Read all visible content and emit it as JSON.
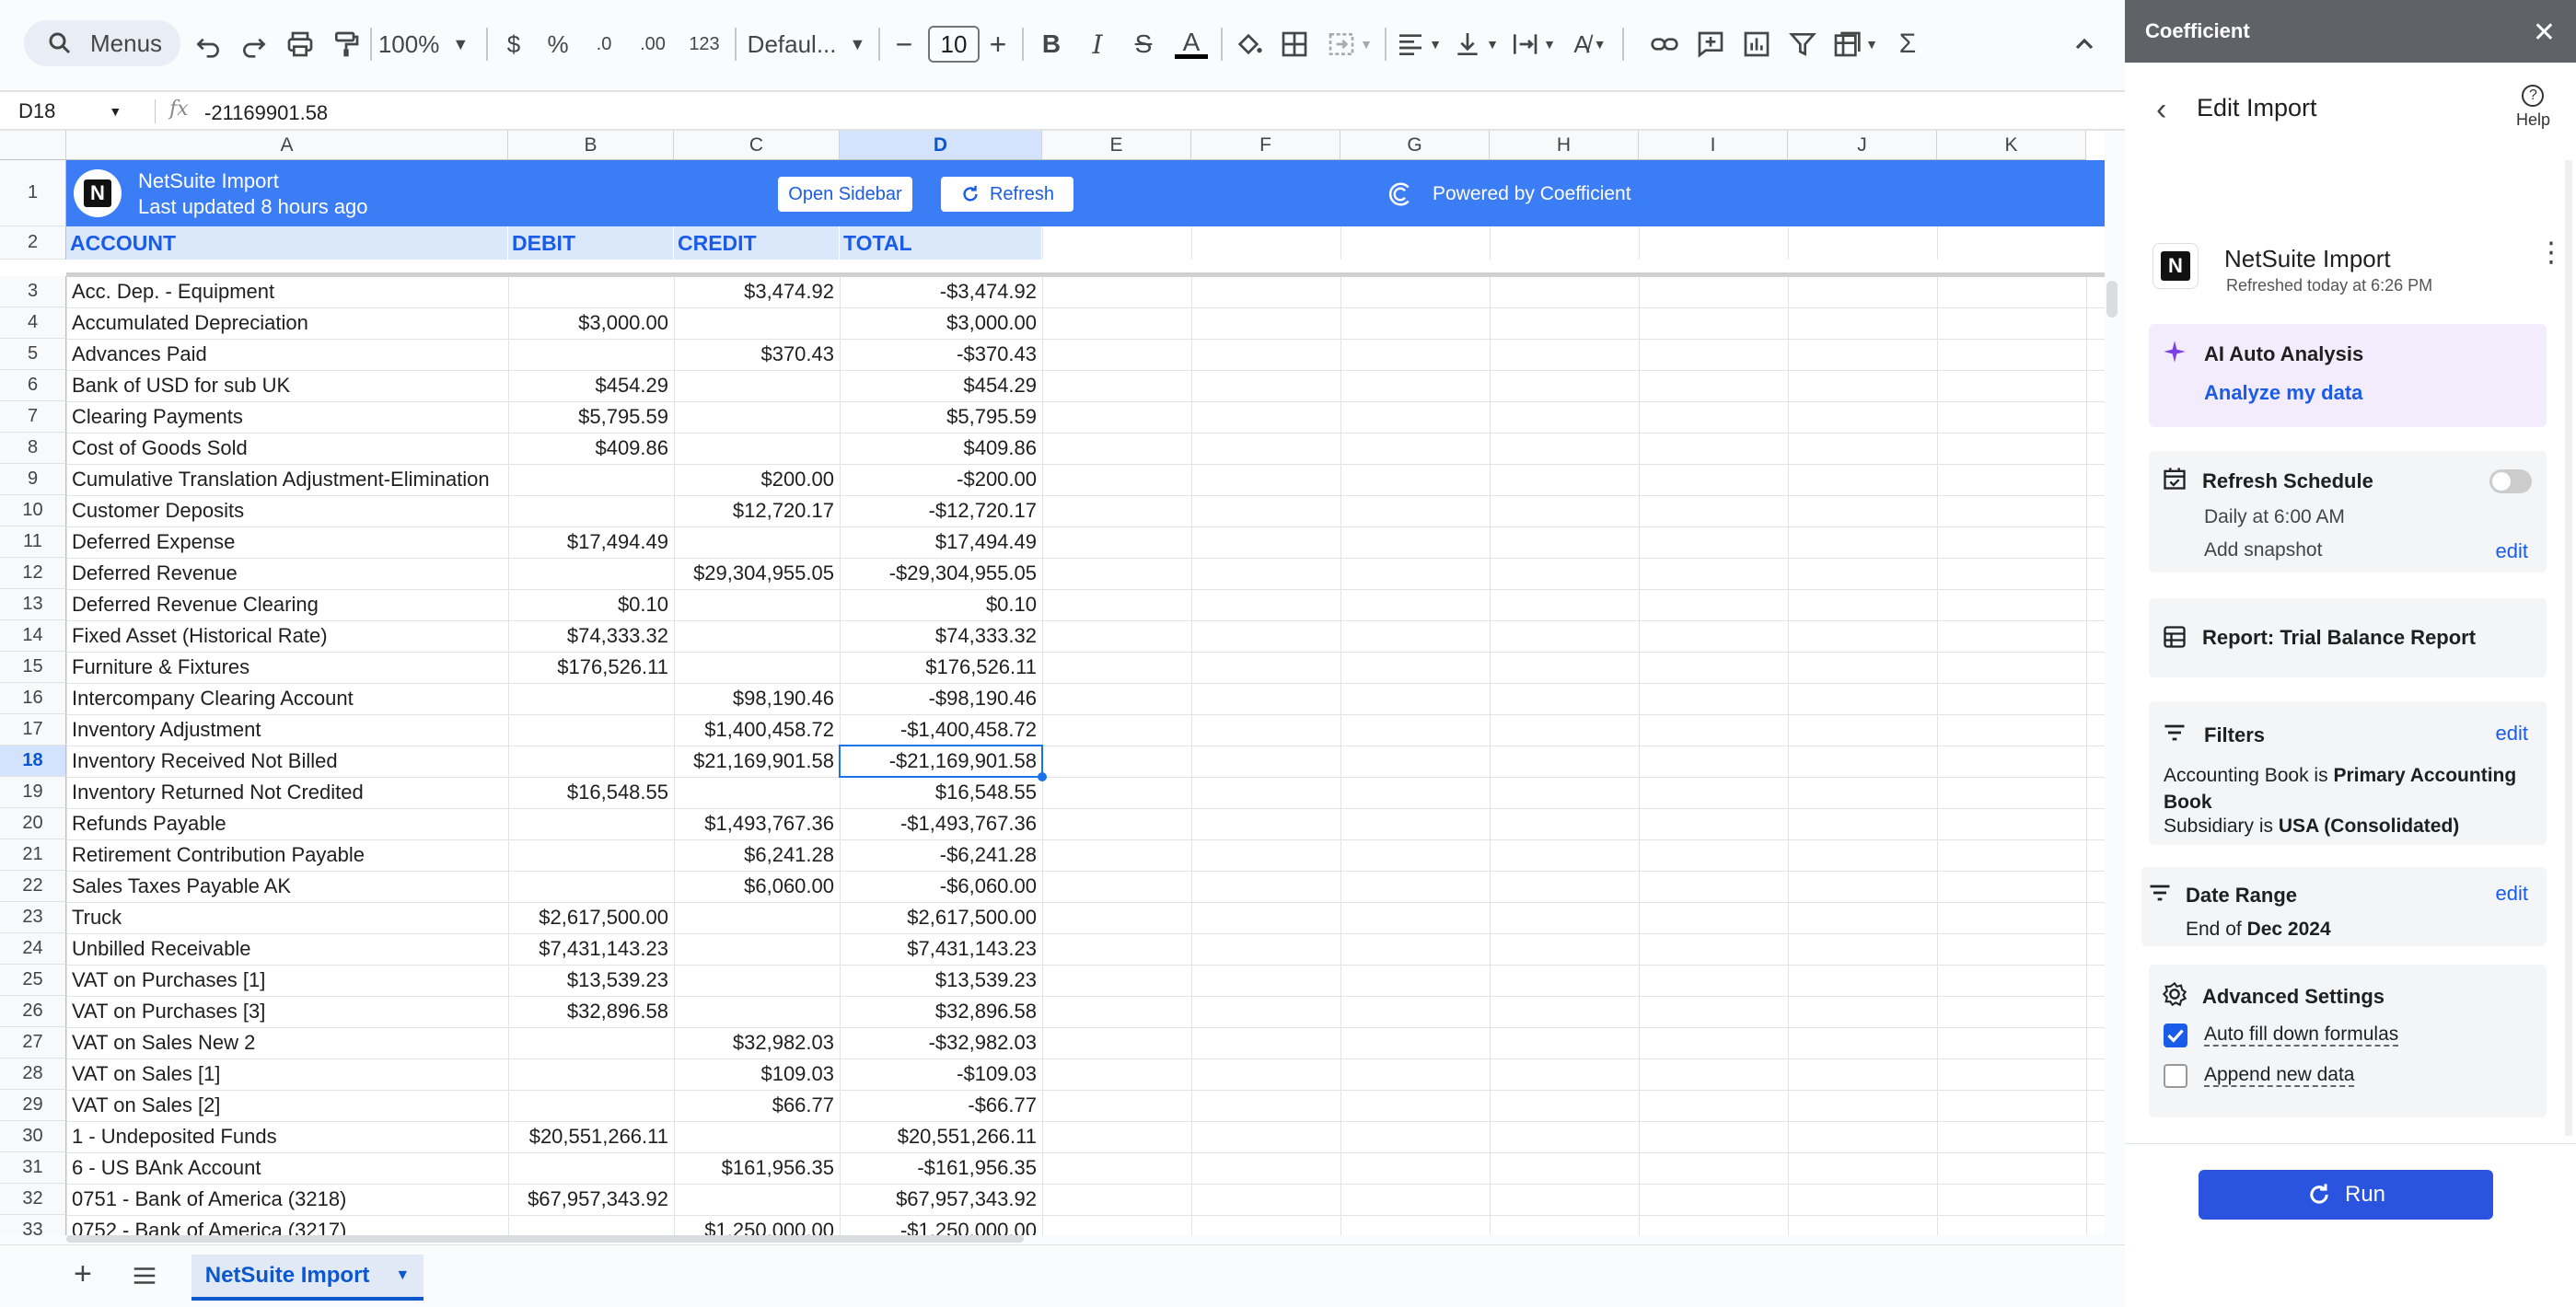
{
  "toolbar": {
    "menus_label": "Menus",
    "zoom": "100%",
    "currency": "$",
    "percent": "%",
    "dec_decrease": ".0",
    "dec_increase": ".00",
    "number_format": "123",
    "font": "Defaul...",
    "font_size": "10"
  },
  "formula_bar": {
    "cell_ref": "D18",
    "fx": "fx",
    "formula": "-21169901.58"
  },
  "columns": [
    "A",
    "B",
    "C",
    "D",
    "E",
    "F",
    "G",
    "H",
    "I",
    "J",
    "K"
  ],
  "rows": [
    "1",
    "2",
    "3",
    "4",
    "5",
    "6",
    "7",
    "8",
    "9",
    "10",
    "11",
    "12",
    "13",
    "14",
    "15",
    "16",
    "17",
    "18",
    "19",
    "20",
    "21",
    "22",
    "23",
    "24",
    "25",
    "26",
    "27",
    "28",
    "29",
    "30",
    "31",
    "32",
    "33"
  ],
  "banner": {
    "logo": "N",
    "title": "NetSuite Import",
    "updated": "Last updated 8 hours ago",
    "open_sidebar": "Open Sidebar",
    "refresh": "Refresh",
    "powered": "Powered by Coefficient"
  },
  "headers": {
    "account": "ACCOUNT",
    "debit": "DEBIT",
    "credit": "CREDIT",
    "total": "TOTAL"
  },
  "table": [
    {
      "account": "Acc. Dep. - Equipment",
      "debit": "",
      "credit": "$3,474.92",
      "total": "-$3,474.92"
    },
    {
      "account": "Accumulated Depreciation",
      "debit": "$3,000.00",
      "credit": "",
      "total": "$3,000.00"
    },
    {
      "account": "Advances Paid",
      "debit": "",
      "credit": "$370.43",
      "total": "-$370.43"
    },
    {
      "account": "Bank of USD for sub UK",
      "debit": "$454.29",
      "credit": "",
      "total": "$454.29"
    },
    {
      "account": "Clearing Payments",
      "debit": "$5,795.59",
      "credit": "",
      "total": "$5,795.59"
    },
    {
      "account": "Cost of Goods Sold",
      "debit": "$409.86",
      "credit": "",
      "total": "$409.86"
    },
    {
      "account": "Cumulative Translation Adjustment-Elimination",
      "debit": "",
      "credit": "$200.00",
      "total": "-$200.00"
    },
    {
      "account": "Customer Deposits",
      "debit": "",
      "credit": "$12,720.17",
      "total": "-$12,720.17"
    },
    {
      "account": "Deferred Expense",
      "debit": "$17,494.49",
      "credit": "",
      "total": "$17,494.49"
    },
    {
      "account": "Deferred Revenue",
      "debit": "",
      "credit": "$29,304,955.05",
      "total": "-$29,304,955.05"
    },
    {
      "account": "Deferred Revenue Clearing",
      "debit": "$0.10",
      "credit": "",
      "total": "$0.10"
    },
    {
      "account": "Fixed Asset (Historical Rate)",
      "debit": "$74,333.32",
      "credit": "",
      "total": "$74,333.32"
    },
    {
      "account": "Furniture & Fixtures",
      "debit": "$176,526.11",
      "credit": "",
      "total": "$176,526.11"
    },
    {
      "account": "Intercompany Clearing Account",
      "debit": "",
      "credit": "$98,190.46",
      "total": "-$98,190.46"
    },
    {
      "account": "Inventory Adjustment",
      "debit": "",
      "credit": "$1,400,458.72",
      "total": "-$1,400,458.72"
    },
    {
      "account": "Inventory Received Not Billed",
      "debit": "",
      "credit": "$21,169,901.58",
      "total": "-$21,169,901.58"
    },
    {
      "account": "Inventory Returned Not Credited",
      "debit": "$16,548.55",
      "credit": "",
      "total": "$16,548.55"
    },
    {
      "account": "Refunds Payable",
      "debit": "",
      "credit": "$1,493,767.36",
      "total": "-$1,493,767.36"
    },
    {
      "account": "Retirement Contribution Payable",
      "debit": "",
      "credit": "$6,241.28",
      "total": "-$6,241.28"
    },
    {
      "account": "Sales Taxes Payable AK",
      "debit": "",
      "credit": "$6,060.00",
      "total": "-$6,060.00"
    },
    {
      "account": "Truck",
      "debit": "$2,617,500.00",
      "credit": "",
      "total": "$2,617,500.00"
    },
    {
      "account": "Unbilled Receivable",
      "debit": "$7,431,143.23",
      "credit": "",
      "total": "$7,431,143.23"
    },
    {
      "account": "VAT on Purchases [1]",
      "debit": "$13,539.23",
      "credit": "",
      "total": "$13,539.23"
    },
    {
      "account": "VAT on Purchases [3]",
      "debit": "$32,896.58",
      "credit": "",
      "total": "$32,896.58"
    },
    {
      "account": "VAT on Sales New 2",
      "debit": "",
      "credit": "$32,982.03",
      "total": "-$32,982.03"
    },
    {
      "account": "VAT on Sales [1]",
      "debit": "",
      "credit": "$109.03",
      "total": "-$109.03"
    },
    {
      "account": "VAT on Sales [2]",
      "debit": "",
      "credit": "$66.77",
      "total": "-$66.77"
    },
    {
      "account": "1 - Undeposited Funds",
      "debit": "$20,551,266.11",
      "credit": "",
      "total": "$20,551,266.11"
    },
    {
      "account": "6 - US BAnk Account",
      "debit": "",
      "credit": "$161,956.35",
      "total": "-$161,956.35"
    },
    {
      "account": "0751 - Bank of America (3218)",
      "debit": "$67,957,343.92",
      "credit": "",
      "total": "$67,957,343.92"
    },
    {
      "account": "0752 - Bank of America (3217)",
      "debit": "",
      "credit": "$1,250,000.00",
      "total": "-$1,250,000.00"
    }
  ],
  "sheet_tab": "NetSuite Import",
  "panel": {
    "brand": "Coefficient",
    "close": "✕",
    "title": "Edit Import",
    "help": "Help",
    "import_name": "NetSuite Import",
    "import_logo": "N",
    "refreshed": "Refreshed today at 6:26 PM",
    "ai_title": "AI Auto Analysis",
    "ai_link": "Analyze my data",
    "schedule_title": "Refresh Schedule",
    "schedule_time": "Daily at 6:00 AM",
    "snapshot": "Add snapshot",
    "edit": "edit",
    "report": "Report: Trial Balance Report",
    "filters_title": "Filters",
    "filter1_prefix": "Accounting Book is ",
    "filter1_value": "Primary Accounting Book",
    "filter2_prefix": "Subsidiary is ",
    "filter2_value": "USA (Consolidated)",
    "date_title": "Date Range",
    "date_prefix": "End of ",
    "date_value": "Dec 2024",
    "adv_title": "Advanced Settings",
    "opt1": "Auto fill down formulas",
    "opt2": "Append new data",
    "run": "Run"
  },
  "colors": {
    "banner": "#3b7df5",
    "accent": "#1a5be8",
    "selection": "#1a73e8",
    "ai_card": "#f2ecfd"
  }
}
